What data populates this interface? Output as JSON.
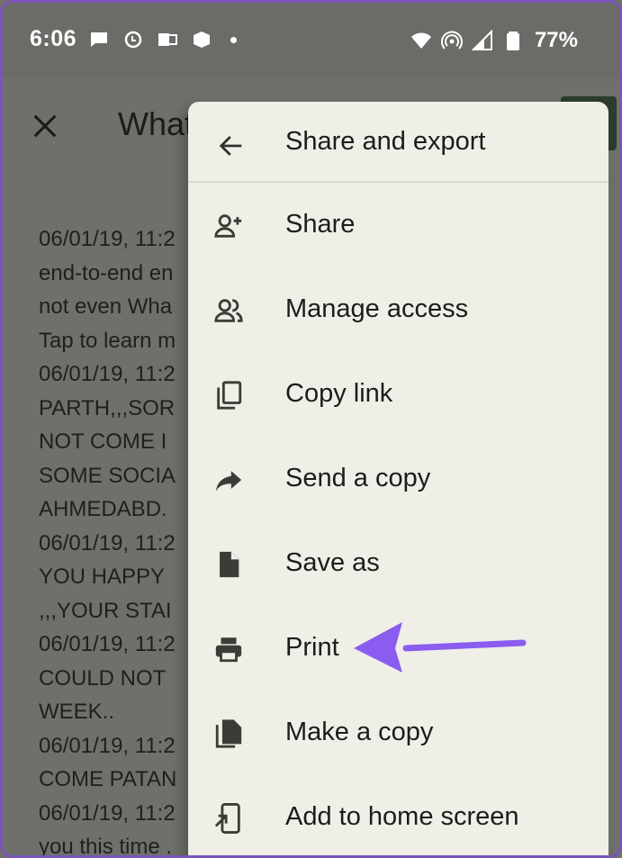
{
  "status_bar": {
    "time": "6:06",
    "battery": "77%",
    "left_icons": [
      "chat-bubble-icon",
      "sync-icon",
      "outlook-icon",
      "box-icon",
      "notification-dot"
    ],
    "right_icons": [
      "wifi-icon",
      "hotspot-icon",
      "signal-icon",
      "battery-icon"
    ]
  },
  "app_bar": {
    "title": "What"
  },
  "document": {
    "lines": [
      "06/01/19, 11:2",
      "end-to-end en",
      "not even Wha",
      "Tap to learn m",
      "06/01/19, 11:2",
      "PARTH,,,SOR",
      "NOT COME I",
      "SOME SOCIA",
      "AHMEDABD.",
      "06/01/19, 11:2",
      "YOU HAPPY",
      ",,,YOUR STAI",
      "06/01/19, 11:2",
      "COULD NOT",
      "WEEK..",
      "06/01/19, 11:2",
      "COME PATAN",
      "06/01/19, 11:2",
      "you this time ."
    ]
  },
  "menu": {
    "title": "Share and export",
    "items": [
      {
        "label": "Share",
        "icon": "person-add-icon"
      },
      {
        "label": "Manage access",
        "icon": "people-icon"
      },
      {
        "label": "Copy link",
        "icon": "copy-icon"
      },
      {
        "label": "Send a copy",
        "icon": "forward-arrow-icon"
      },
      {
        "label": "Save as",
        "icon": "file-icon"
      },
      {
        "label": "Print",
        "icon": "print-icon"
      },
      {
        "label": "Make a copy",
        "icon": "file-copy-icon"
      },
      {
        "label": "Add to home screen",
        "icon": "add-to-home-icon"
      }
    ]
  },
  "colors": {
    "accent_arrow": "#8a5cf0",
    "menu_bg": "#efefe8",
    "scrim": "#6f706b"
  }
}
